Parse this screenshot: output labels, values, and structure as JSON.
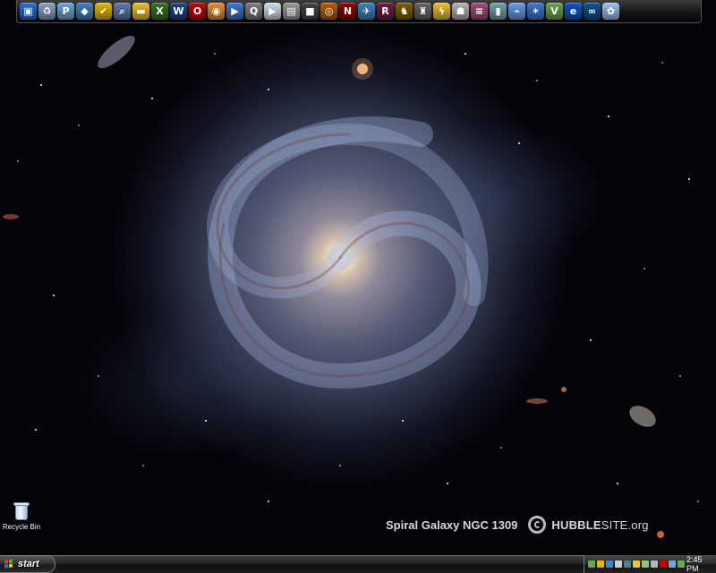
{
  "desktop": {
    "wallpaper_caption": "Spiral Galaxy NGC 1309",
    "wallpaper_site_bold": "HUBBLE",
    "wallpaper_site_rest": "SITE.org",
    "icons": [
      {
        "label": "Recycle Bin",
        "icon": "recycle-bin-icon"
      }
    ]
  },
  "dock": {
    "icons": [
      {
        "name": "my-computer-icon",
        "glyph": "▣",
        "color": "#2f6fd6"
      },
      {
        "name": "recycle-bin-icon",
        "glyph": "♻",
        "color": "#8aa6c9"
      },
      {
        "name": "paint-icon",
        "glyph": "P",
        "color": "#6fa8dc"
      },
      {
        "name": "network-icon",
        "glyph": "◆",
        "color": "#3d85c6"
      },
      {
        "name": "nero-icon",
        "glyph": "✔",
        "color": "#e6b800"
      },
      {
        "name": "search-icon",
        "glyph": "⌕",
        "color": "#5b7db1"
      },
      {
        "name": "folder-icon",
        "glyph": "▬",
        "color": "#f1c232"
      },
      {
        "name": "excel-icon",
        "glyph": "X",
        "color": "#38761d"
      },
      {
        "name": "word-icon",
        "glyph": "W",
        "color": "#1c4587"
      },
      {
        "name": "opera-icon",
        "glyph": "O",
        "color": "#cc0000"
      },
      {
        "name": "firefox-icon",
        "glyph": "◉",
        "color": "#e69138"
      },
      {
        "name": "media-player-icon",
        "glyph": "▶",
        "color": "#3c78d8"
      },
      {
        "name": "quicktime-icon",
        "glyph": "Q",
        "color": "#7f7f7f"
      },
      {
        "name": "music-player-icon",
        "glyph": "▶",
        "color": "#cfe2f3"
      },
      {
        "name": "video-editor-icon",
        "glyph": "▤",
        "color": "#999999"
      },
      {
        "name": "camera-icon",
        "glyph": "■",
        "color": "#444444"
      },
      {
        "name": "eye-icon",
        "glyph": "◎",
        "color": "#b45f06"
      },
      {
        "name": "nascar-game-icon",
        "glyph": "N",
        "color": "#990000"
      },
      {
        "name": "flight-sim-icon",
        "glyph": "✈",
        "color": "#3d85c6"
      },
      {
        "name": "racing-game-icon",
        "glyph": "R",
        "color": "#741b47"
      },
      {
        "name": "soldier-game-icon",
        "glyph": "♞",
        "color": "#7f6000"
      },
      {
        "name": "droid-game-icon",
        "glyph": "♜",
        "color": "#666666"
      },
      {
        "name": "winamp-icon",
        "glyph": "ϟ",
        "color": "#f1c232"
      },
      {
        "name": "trooper-game-icon",
        "glyph": "☗",
        "color": "#b7b7b7"
      },
      {
        "name": "winrar-icon",
        "glyph": "≡",
        "color": "#a64d79"
      },
      {
        "name": "tool-icon",
        "glyph": "▮",
        "color": "#76a5af"
      },
      {
        "name": "satellite-icon",
        "glyph": "⌁",
        "color": "#6d9eeb"
      },
      {
        "name": "rebel-icon",
        "glyph": "✶",
        "color": "#3c78d8"
      },
      {
        "name": "nvidia-icon",
        "glyph": "V",
        "color": "#6aa84f"
      },
      {
        "name": "ie-icon",
        "glyph": "e",
        "color": "#1155cc"
      },
      {
        "name": "game-controller-icon",
        "glyph": "∞",
        "color": "#0b5394"
      },
      {
        "name": "system-tool-icon",
        "glyph": "✿",
        "color": "#a4c2f4"
      }
    ]
  },
  "taskbar": {
    "start_label": "start",
    "clock": "2:45 PM",
    "tray_icons": [
      {
        "name": "network-tray-icon",
        "color": "#6aa84f"
      },
      {
        "name": "antivirus-tray-icon",
        "color": "#e6b800"
      },
      {
        "name": "display-tray-icon",
        "color": "#3d85c6"
      },
      {
        "name": "mail-tray-icon",
        "color": "#cccccc"
      },
      {
        "name": "update-tray-icon",
        "color": "#45818e"
      },
      {
        "name": "nero-tray-icon",
        "color": "#f1c232"
      },
      {
        "name": "messenger-tray-icon",
        "color": "#93c47d"
      },
      {
        "name": "volume-tray-icon",
        "color": "#b7b7b7"
      },
      {
        "name": "security-tray-icon",
        "color": "#cc0000"
      },
      {
        "name": "sound-tray-icon",
        "color": "#6fa8dc"
      },
      {
        "name": "nvidia-tray-icon",
        "color": "#6aa84f"
      }
    ]
  }
}
